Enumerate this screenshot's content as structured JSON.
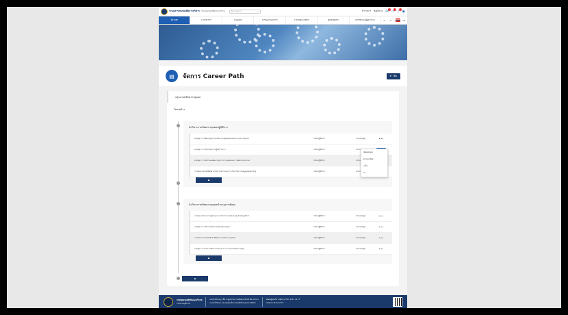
{
  "colors": {
    "primary": "#1e5fb4",
    "dark_navy": "#1a3a6b",
    "badge_red": "#dd3333"
  },
  "topbar": {
    "brand": "ระบบสารสนเทศเพื่อการบริหาร",
    "brand_sub": "กรมคุ้มครองสิทธิและเสรีภาพ",
    "search_placeholder": "ค้นหาเมนูงาน",
    "user_role": "ข้าราชการ",
    "user_name": "ชื่อผู้ใช้งาน",
    "icons": [
      "search-icon",
      "mail-icon",
      "chat-icon",
      "bell-icon",
      "user-icon"
    ],
    "badges": [
      "2",
      "1",
      "3"
    ]
  },
  "nav": {
    "items": [
      "หน้าหลัก",
      "งานวิชาการ",
      "งานบุคคล",
      "การพัฒนาบุคลากร",
      "งานวินัยและนิติกร",
      "ผู้บังคับบัญชา",
      "กิจกรรมและผู้ดูแลระบบ"
    ],
    "active_index": 0,
    "lang": "TH"
  },
  "header": {
    "title": "จัดการ Career Path",
    "add_label": "เพิ่ม"
  },
  "content": {
    "group_label": "กลุ่มงานทรัพยากรบุคคล",
    "structure_label": "โครงสร้าง",
    "sections": [
      {
        "title": "นักวิชาการทรัพยากรบุคคลปฏิบัติการ",
        "rows": [
          {
            "name": "หลักสูตร การพัฒนาผู้บริหารทรัพยากรบุคคลยุคใหม่และระบบสารสนเทศ",
            "level": "ระดับปฏิบัติการ",
            "count": "1/2 หลักสูตร"
          },
          {
            "name": "หลักสูตร การบริหารผลการปฏิบัติราชการ",
            "level": "ระดับปฏิบัติการ",
            "count": "1/2 หลักสูตร"
          },
          {
            "name": "หลักสูตร การจัดทำแผนพัฒนาบุคลากรรายบุคคลและการพัฒนาสมรรถนะ",
            "level": "ระดับปฏิบัติการ",
            "count": "1/2 หลักสูตร"
          },
          {
            "name": "การพัฒนาทักษะดิจิทัลสำหรับข้าราชการและการบริหารจัดการข้อมูลบุคคลภาครัฐ",
            "level": "ระดับปฏิบัติการ",
            "count": "1/2 หลักสูตร"
          }
        ]
      },
      {
        "title": "นักวิชาการทรัพยากรบุคคลชำนาญการพิเศษ",
        "rows": [
          {
            "name": "การพัฒนาทักษะภาวะผู้นำและการบริหารการเปลี่ยนแปลงสำหรับผู้บริหาร",
            "level": "ระดับปฏิบัติการ",
            "count": "1/2 หลักสูตร"
          },
          {
            "name": "หลักสูตร การบริหารทรัพยากรบุคคลเชิงกลยุทธ์",
            "level": "ระดับปฏิบัติการ",
            "count": "1/2 หลักสูตร"
          },
          {
            "name": "การพัฒนาความเป็นมืออาชีพด้านการบริหารงานบุคคล",
            "level": "ระดับปฏิบัติการ",
            "count": "1/2 หลักสูตร"
          },
          {
            "name": "หลักสูตร การวิเคราะห์อัตรากำลังและการวางแผนกำลังคนภาครัฐ",
            "level": "ระดับปฏิบัติการ",
            "count": "1/2 หลักสูตร"
          }
        ]
      }
    ],
    "add_icon": "add-icon",
    "row_more": "•••"
  },
  "row_menu": {
    "items": [
      "เพิ่มหลักสูตร",
      "ดูรายละเอียด",
      "แก้ไข",
      "ลบ"
    ]
  },
  "footer": {
    "org_name": "กรมคุ้มครองสิทธิและเสรีภาพ",
    "org_sub": "กระทรวงยุติธรรม",
    "address_1": "เลขที่ 120 หมู่ 3 ชั้น 5 ศูนย์ราชการเฉลิมพระเกียรติ 80 พรรษาฯ",
    "address_2": "ถนนแจ้งวัฒนะ แขวงทุ่งสองห้อง เขตหลักสี่ กรุงเทพฯ 10210",
    "contact_1": "ติดต่อศูนย์บริการยุติธรรม โทร 1111 กด 77",
    "contact_2": "สายด่วน 1111 กด 77"
  }
}
